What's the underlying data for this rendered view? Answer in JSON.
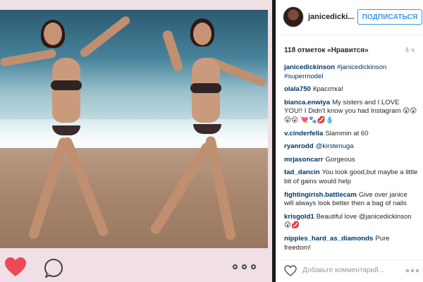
{
  "header": {
    "username": "janicedickinson",
    "username_display": "janicedicki...",
    "follow_label": "ПОДПИСАТЬСЯ"
  },
  "post": {
    "likes": "118 отметок «Нравится»",
    "time": "4 ч"
  },
  "comments": [
    {
      "user": "janicedickinson",
      "text": "#janicedickinson #supermodel"
    },
    {
      "user": "olala750",
      "text": "Красотка!"
    },
    {
      "user": "bianca.enwiya",
      "text": "My sisters and I LOVE YOU!! I Didn't know you had Instagram 😮😮😮😮 💘🐾💋💧"
    },
    {
      "user": "v.cinderfella",
      "text": "Slammin at 60"
    },
    {
      "user": "ryanrodd",
      "text": "@kirstenuga"
    },
    {
      "user": "mrjasoncarr",
      "text": "Gorgeous"
    },
    {
      "user": "tad_dancin",
      "text": "You look good,but maybe a little bit of gains would help"
    },
    {
      "user": "fightingirish.battlecam",
      "text": "Give over janice will always look better then a bag of nails"
    },
    {
      "user": "krisgold1",
      "text": "Beautiful love @janicedickinson 😮💋"
    },
    {
      "user": "nipples_hard_as_diamonds",
      "text": "Pure freedom!"
    }
  ],
  "footer": {
    "add_comment_placeholder": "Добавьте комментарий..."
  },
  "icons": {
    "like": "heart-icon",
    "comment": "comment-icon",
    "more": "more-icon"
  },
  "colors": {
    "heart_red": "#ed4956",
    "link_blue": "#003569",
    "follow_blue": "#3897f0"
  }
}
